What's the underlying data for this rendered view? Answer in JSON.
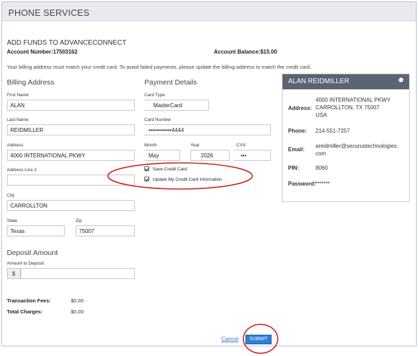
{
  "page": {
    "title": "PHONE SERVICES"
  },
  "funds": {
    "heading": "ADD FUNDS TO ADVANCECONNECT",
    "account_number": "Account Number:17503162",
    "account_balance": "Account Balance:$15.00",
    "notice": "Your billing address must match your credit card. To avoid failed payments, please update the billing address to match the credit card."
  },
  "billing": {
    "heading": "Billing Address",
    "first_name_label": "First Name",
    "first_name": "ALAN",
    "last_name_label": "Last Name",
    "last_name": "REIDMILLER",
    "address_label": "Address",
    "address": "4000 INTERNATIONAL PKWY",
    "address2_label": "Address Line 2",
    "address2": "",
    "city_label": "City",
    "city": "CARROLLTON",
    "state_label": "State",
    "state": "Texas",
    "zip_label": "Zip",
    "zip": "75007"
  },
  "payment": {
    "heading": "Payment Details",
    "card_type_label": "Card Type",
    "card_type": "MasterCard",
    "card_number_label": "Card Number",
    "card_number": "••••••••••••4444",
    "month_label": "Month",
    "month": "May",
    "year_label": "Year",
    "year": "2026",
    "cvv_label": "CVV",
    "cvv": "•••",
    "save_card_label": "Save Credit Card",
    "update_card_label": "Update My Credit Card Information"
  },
  "user": {
    "name": "ALAN REIDMILLER",
    "address_label": "Address:",
    "address_lines": [
      "4000 INTERNATIONAL PKWY",
      "CARROLLTON, TX 75007",
      "USA"
    ],
    "phone_label": "Phone:",
    "phone": "214-551-7257",
    "email_label": "Email:",
    "email_lines": [
      "areidmiller@securustechnologies.",
      "com"
    ],
    "pin_label": "PIN:",
    "pin": "8060",
    "password_label": "Password:",
    "password": "*******"
  },
  "deposit": {
    "heading": "Deposit Amount",
    "amount_label": "Amount to Deposit:",
    "currency_symbol": "$",
    "amount": ""
  },
  "totals": {
    "fees_label": "Transaction Fees:",
    "fees": "$0.00",
    "total_label": "Total Charges:",
    "total": "$0.00"
  },
  "actions": {
    "cancel": "Cancel",
    "submit": "SUBMIT"
  },
  "colors": {
    "accent": "#2f7fd4",
    "annotation": "#d42020",
    "panel_header": "#5a6473"
  }
}
